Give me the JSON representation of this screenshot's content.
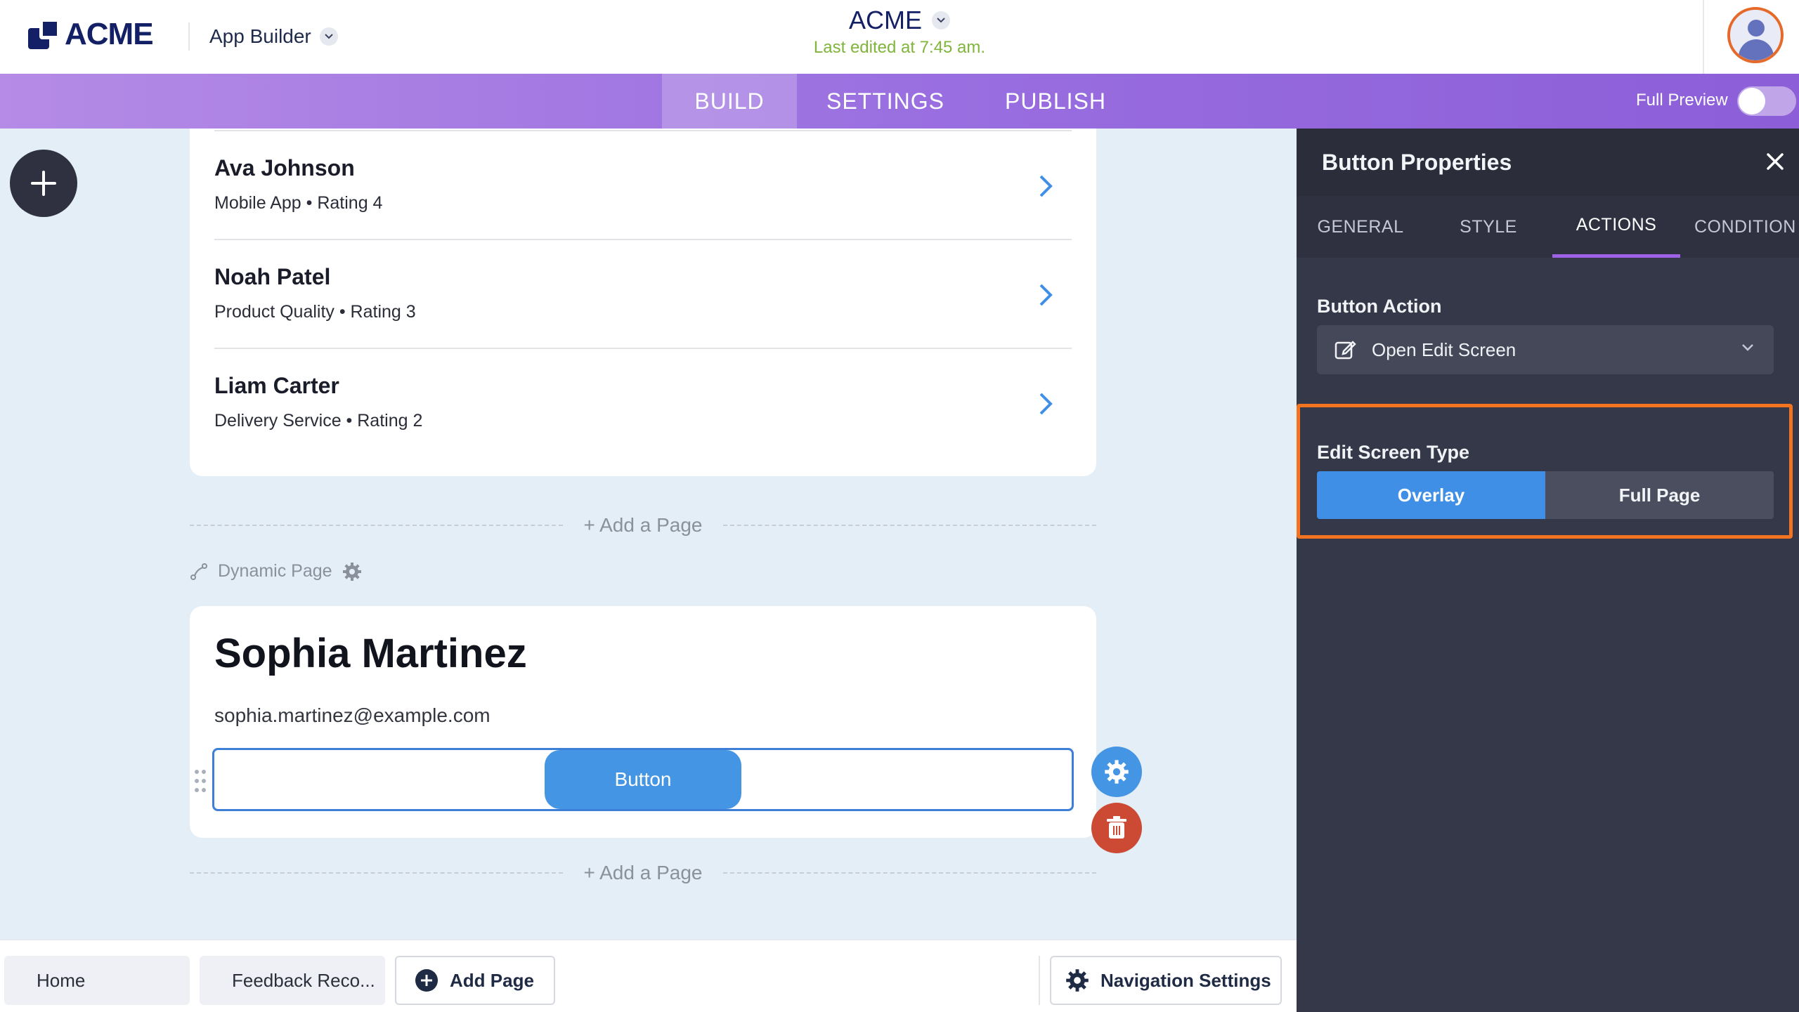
{
  "header": {
    "logo_text": "ACME",
    "app_builder_label": "App Builder",
    "app_name": "ACME",
    "last_edited": "Last edited at 7:45 am."
  },
  "nav": {
    "tabs": [
      {
        "label": "BUILD",
        "active": true
      },
      {
        "label": "SETTINGS",
        "active": false
      },
      {
        "label": "PUBLISH",
        "active": false
      }
    ],
    "full_preview_label": "Full Preview",
    "full_preview_on": false
  },
  "canvas": {
    "list_items": [
      {
        "title": "Ava Johnson",
        "subtitle": "Mobile App • Rating 4"
      },
      {
        "title": "Noah Patel",
        "subtitle": "Product Quality • Rating 3"
      },
      {
        "title": "Liam Carter",
        "subtitle": "Delivery Service • Rating 2"
      }
    ],
    "add_page_label": "Add a Page",
    "add_page_plus": "+",
    "dynamic_page_label": "Dynamic Page",
    "detail": {
      "name": "Sophia Martinez",
      "email": "sophia.martinez@example.com",
      "button_label": "Button"
    }
  },
  "bottom_bar": {
    "home_label": "Home",
    "feedback_label": "Feedback Reco...",
    "add_page_label": "Add Page",
    "nav_settings_label": "Navigation Settings"
  },
  "panel": {
    "title": "Button Properties",
    "tabs": [
      {
        "label": "GENERAL",
        "active": false
      },
      {
        "label": "STYLE",
        "active": false
      },
      {
        "label": "ACTIONS",
        "active": true
      },
      {
        "label": "CONDITION",
        "active": false
      }
    ],
    "button_action_label": "Button Action",
    "button_action_value": "Open Edit Screen",
    "edit_screen_type_label": "Edit Screen Type",
    "edit_screen_options": [
      "Overlay",
      "Full Page"
    ],
    "edit_screen_selected": "Overlay"
  },
  "colors": {
    "accent_blue": "#4495e4",
    "highlight_orange": "#f27420",
    "delete_red": "#cc4a33",
    "brand_navy": "#142066",
    "edited_green": "#7fb53a"
  }
}
